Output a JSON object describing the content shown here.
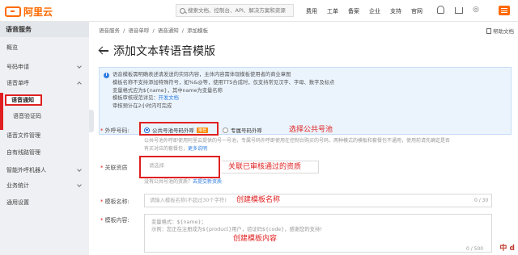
{
  "header": {
    "brand": "阿里云",
    "search_placeholder": "搜索文档、控制台、API、解决方案和资源",
    "nav": [
      "费用",
      "工单",
      "备案",
      "企业",
      "支持",
      "官网"
    ]
  },
  "sidebar": {
    "title": "语音服务",
    "items": [
      {
        "label": "概览"
      },
      {
        "label": "号码申请"
      },
      {
        "label": "语音单呼"
      },
      {
        "label": "语音通知"
      },
      {
        "label": "语音验证码"
      },
      {
        "label": "语音文件管理"
      },
      {
        "label": "自有线路管理"
      },
      {
        "label": "智能外呼机器人"
      },
      {
        "label": "业务统计"
      },
      {
        "label": "通用设置"
      }
    ]
  },
  "breadcrumb": [
    "语音服务",
    "/",
    "语音单呼",
    "/",
    "语音通知",
    "/",
    "添加模板"
  ],
  "help_label": "帮助文档",
  "page_title": "添加文本转语音模版",
  "notice": {
    "line1": "语音模板需明确表述请发送的实际内容，主体内容需体现模板使用者的商业章图",
    "line2": "模板名称不支持添加特殊符号，如%&@等，使用TTS合成时，仅支持常见汉字、字母、数字及标点",
    "line3": "变量格式应为${name}，其中name为变量名称",
    "line4_prefix": "模板审核规范详见：",
    "line4_link": "开发文档",
    "line5": "审核预计在2小时内可完成"
  },
  "form": {
    "number_label": "外呼号码:",
    "opt_public": "公共号池号码外呼",
    "opt_public_tag": "推荐",
    "opt_private": "专属号码外呼",
    "number_hint1": "公共号池外呼即使用阿里云提供的号一号池，专属号码外呼即使用在控制台购买的号码，两种模式的模板和套餐包不通用，使用前请先确定是否",
    "number_hint2": "有买对应的套餐包，",
    "number_hint_link": "更多说明",
    "qual_label": "关联资质",
    "qual_placeholder": "请选择",
    "qual_hint_prefix": "没有公共号池的资质？",
    "qual_hint_link": "去提交新资质",
    "name_label": "模板名称:",
    "name_placeholder": "请输入模板名称(不超过30个字符)",
    "name_counter": "0 / 30",
    "content_label": "模板内容:",
    "content_line1": "变量格式：${name}；",
    "content_line2": "示例：您正在注册成为${product}用户，验证码${code}，感谢您的支持!",
    "content_counter": "0 / 500"
  },
  "annotations": {
    "a1": "选择公共号池",
    "a2": "关联已审核通过的资质",
    "a3": "创建模板名称",
    "a4": "创建模板内容"
  },
  "watermark": "中 d"
}
